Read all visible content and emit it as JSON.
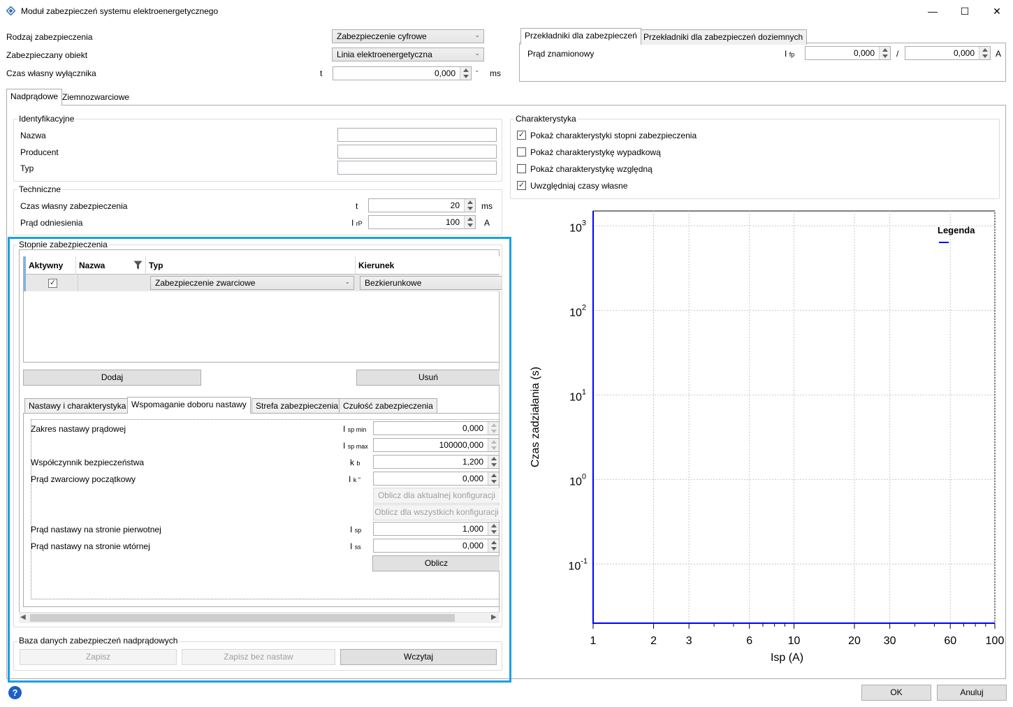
{
  "window": {
    "title": "Moduł zabezpieczeń systemu elektroenergetycznego",
    "buttons": {
      "minimize": "—",
      "maximize": "☐",
      "close": "✕"
    }
  },
  "top": {
    "protection_type_label": "Rodzaj zabezpieczenia",
    "protection_type_value": "Zabezpieczenie cyfrowe",
    "protected_object_label": "Zabezpieczany obiekt",
    "protected_object_value": "Linia elektroenergetyczna",
    "breaker_time_label": "Czas własny wyłącznika",
    "breaker_time_symbol": "t",
    "breaker_time_value": "0,000",
    "breaker_time_unit": "ms"
  },
  "transformers": {
    "tabs": [
      "Przekładniki dla zabezpieczeń",
      "Przekładniki dla zabezpieczeń doziemnych"
    ],
    "rated_current_label": "Prąd znamionowy",
    "symbol": "I",
    "symbol_sub": "fp",
    "primary": "0,000",
    "separator": "/",
    "secondary": "0,000",
    "unit": "A"
  },
  "main_tabs": [
    "Nadprądowe",
    "Ziemnozwarciowe"
  ],
  "identification": {
    "title": "Identyfikacyjne",
    "name_label": "Nazwa",
    "producer_label": "Producent",
    "type_label": "Typ"
  },
  "technical": {
    "title": "Techniczne",
    "own_time_label": "Czas własny zabezpieczenia",
    "own_time_symbol": "t",
    "own_time_value": "20",
    "own_time_unit": "ms",
    "ref_current_label": "Prąd odniesienia",
    "ref_current_symbol": "I",
    "ref_current_sub": "rP",
    "ref_current_value": "100",
    "ref_current_unit": "A"
  },
  "stages": {
    "title": "Stopnie zabezpieczenia",
    "columns": [
      "Aktywny",
      "Nazwa",
      "Typ",
      "Kierunek"
    ],
    "row": {
      "type": "Zabezpieczenie zwarciowe",
      "direction": "Bezkierunkowe"
    },
    "add": "Dodaj",
    "remove": "Usuń",
    "sub_tabs": [
      "Nastawy i charakterystyka",
      "Wspomaganie doboru nastawy",
      "Strefa zabezpieczenia",
      "Czułość zabezpieczenia"
    ]
  },
  "assist": {
    "range_label": "Zakres nastawy prądowej",
    "min_sym": "I",
    "min_sub": "sp min",
    "min_value": "0,000",
    "max_sym": "I",
    "max_sub": "sp max",
    "max_value": "100000,000",
    "safety_label": "Współczynnik bezpieczeństwa",
    "safety_sym": "k",
    "safety_sub": "b",
    "safety_value": "1,200",
    "initial_label": "Prąd zwarciowy początkowy",
    "initial_sym": "I",
    "initial_sub": "k \"",
    "initial_value": "0,000",
    "calc_current": "Oblicz dla aktualnej konfiguracji",
    "calc_all": "Oblicz dla wszystkich konfiguracji",
    "primary_label": "Prąd nastawy na stronie pierwotnej",
    "primary_sym": "I",
    "primary_sub": "sp",
    "primary_value": "1,000",
    "secondary_label": "Prąd nastawy na stronie wtórnej",
    "secondary_sym": "I",
    "secondary_sub": "ss",
    "secondary_value": "0,000",
    "calc": "Oblicz"
  },
  "database": {
    "title": "Baza danych zabezpieczeń nadprądowych",
    "save": "Zapisz",
    "save_no_settings": "Zapisz bez nastaw",
    "load": "Wczytaj"
  },
  "characteristic": {
    "title": "Charakterystyka",
    "options": [
      {
        "label": "Pokaż charakterystyki stopni zabezpieczenia",
        "checked": true
      },
      {
        "label": "Pokaż charakterystykę wypadkową",
        "checked": false
      },
      {
        "label": "Pokaż charakterystykę względną",
        "checked": false
      },
      {
        "label": "Uwzględniaj czasy własne",
        "checked": true
      }
    ]
  },
  "chart_data": {
    "type": "line",
    "xlabel": "Isp (A)",
    "ylabel": "Czas zadziałania (s)",
    "xscale": "log",
    "yscale": "log",
    "xlim": [
      1,
      100
    ],
    "ylim": [
      0.02,
      1500
    ],
    "x_ticks": [
      "1",
      "2",
      "3",
      "6",
      "10",
      "20",
      "30",
      "60",
      "100"
    ],
    "x_tick_values": [
      1,
      2,
      3,
      6,
      10,
      20,
      30,
      60,
      100
    ],
    "y_ticks": [
      {
        "base": "10",
        "exp": "3",
        "value": 1000
      },
      {
        "base": "10",
        "exp": "2",
        "value": 100
      },
      {
        "base": "10",
        "exp": "1",
        "value": 10
      },
      {
        "base": "10",
        "exp": "0",
        "value": 1
      },
      {
        "base": "10",
        "exp": "-1",
        "value": 0.1
      }
    ],
    "legend_title": "Legenda",
    "legend_position": "top-right",
    "series": [
      {
        "color": "#0000ff",
        "points": [
          [
            1,
            1500
          ],
          [
            1,
            0.02
          ],
          [
            100,
            0.02
          ]
        ]
      }
    ],
    "grid": true
  },
  "footer": {
    "help": "?",
    "ok": "OK",
    "cancel": "Anuluj"
  }
}
